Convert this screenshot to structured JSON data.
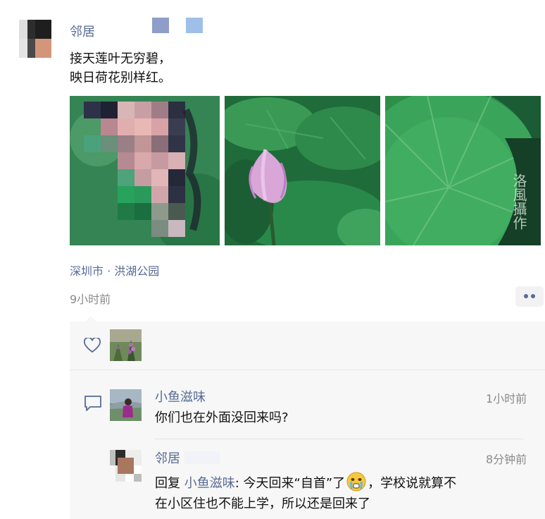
{
  "post": {
    "author": "邻居",
    "text_line1": "接天莲叶无穷碧，",
    "text_line2": "映日荷花别样红。",
    "photo_watermark": "洛風攝作",
    "location": "深圳市 · 洪湖公园",
    "time": "9小时前"
  },
  "likes": {
    "icon": "heart-icon"
  },
  "comments": [
    {
      "author": "小鱼滋味",
      "time": "1小时前",
      "text": "你们也在外面没回来吗?"
    },
    {
      "author": "邻居",
      "time": "8分钟前",
      "reply_prefix": "回复",
      "reply_to": "小鱼滋味",
      "text_before_emoji": ": 今天回来“自首”了",
      "emoji": "crying-face-emoji",
      "text_after_emoji": "，学校说就算不",
      "text_line2": "在小区住也不能上学，所以还是回来了"
    }
  ],
  "colors": {
    "link": "#576b95",
    "meta": "#8a8a8a",
    "panel": "#f7f7f7"
  }
}
